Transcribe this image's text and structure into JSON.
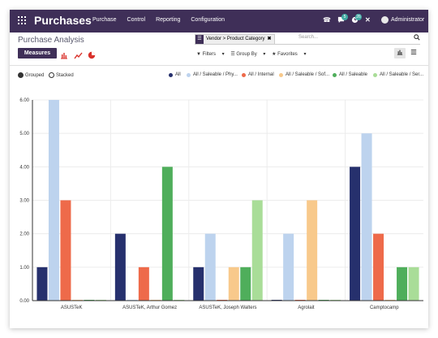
{
  "topbar": {
    "app_name": "Purchases",
    "menu": [
      "Purchase",
      "Control",
      "Reporting",
      "Configuration"
    ],
    "phone_icon": "☎",
    "chat_badge": "5",
    "activity_badge": "26",
    "close_icon": "✕",
    "user": "Administrator"
  },
  "page": {
    "title": "Purchase Analysis"
  },
  "search": {
    "facet_label": "Vendor > Product Category",
    "facet_icon": "☰",
    "facet_remove": "✖",
    "placeholder": "Search...",
    "icon": "⌕"
  },
  "toolbar": {
    "measures_label": "Measures",
    "filters_label": "Filters",
    "groupby_label": "Group By",
    "favorites_label": "Favorites"
  },
  "options": {
    "grouped_label": "Grouped",
    "stacked_label": "Stacked",
    "selected": "grouped"
  },
  "chart_data": {
    "type": "bar",
    "mode": "grouped",
    "categories": [
      "ASUSTeK",
      "ASUSTeK, Arthur Gomez",
      "ASUSTeK, Joseph Walters",
      "Agrolait",
      "Camptocamp"
    ],
    "series": [
      {
        "name": "All",
        "color": "#26306d",
        "values": [
          1,
          2,
          1,
          0,
          4
        ]
      },
      {
        "name": "All / Saleable / Phy...",
        "color": "#bdd3ee",
        "values": [
          6,
          0,
          2,
          2,
          5
        ]
      },
      {
        "name": "All / Internal",
        "color": "#ee6a4a",
        "values": [
          3,
          1,
          0,
          0,
          2
        ]
      },
      {
        "name": "All / Saleable / Sof...",
        "color": "#f8c98b",
        "values": [
          0,
          0,
          1,
          3,
          0
        ]
      },
      {
        "name": "All / Saleable",
        "color": "#4fae5b",
        "values": [
          0,
          4,
          1,
          0,
          1
        ]
      },
      {
        "name": "All / Saleable / Ser...",
        "color": "#a9dd98",
        "values": [
          0,
          0,
          3,
          0,
          1
        ]
      }
    ],
    "ylim": [
      0,
      6
    ],
    "yticks": [
      "0.00",
      "1.00",
      "2.00",
      "3.00",
      "4.00",
      "5.00",
      "6.00"
    ],
    "grid": true,
    "legend_position": "top-right"
  }
}
